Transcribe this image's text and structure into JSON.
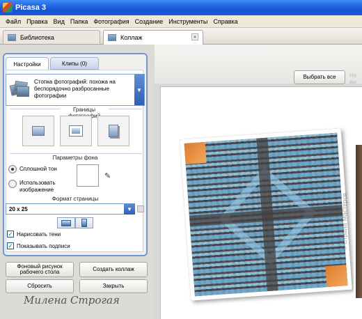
{
  "window": {
    "title": "Picasa 3"
  },
  "menu": [
    "Файл",
    "Правка",
    "Вид",
    "Папка",
    "Фотография",
    "Создание",
    "Инструменты",
    "Справка"
  ],
  "tabs": {
    "library": "Библиотека",
    "collage": "Коллаж",
    "close_glyph": "×"
  },
  "panel": {
    "tab_settings": "Настройки",
    "tab_clips": "Клипы (0)",
    "style_label": "Стопка фотографий: похожа на беспорядочно разбросанные фотографии",
    "dropdown_glyph": "▼",
    "borders_title": "Границы фотографий",
    "background_title": "Параметры фона",
    "radio_solid": "Сплошной тон",
    "radio_image": "Использовать изображение",
    "page_format_title": "Формат страницы",
    "page_format_value": "20 x 25",
    "check_shadows": "Нарисовать тени",
    "check_captions": "Показывать подписи",
    "check_glyph": "✓",
    "eyedropper_glyph": "✎"
  },
  "buttons": {
    "desktop_bg": "Фоновый рисунок рабочего стола",
    "create_collage": "Создать коллаж",
    "reset": "Сбросить",
    "close": "Закрыть",
    "select_all": "Выбрать все",
    "faded": "Не вы"
  },
  "signature": "Милена Строгая",
  "watermark": "© Страна Мастеров"
}
